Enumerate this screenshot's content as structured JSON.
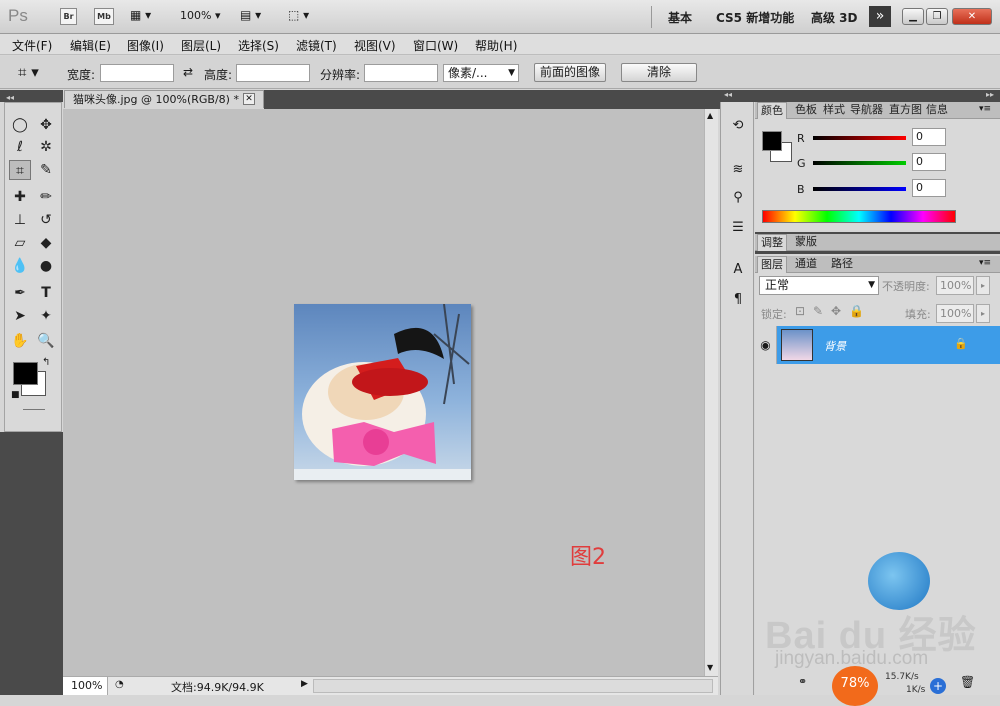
{
  "appbar": {
    "logo": "Ps",
    "bridge": "Br",
    "mini_bridge": "Mb",
    "zoom": "100%",
    "workspaces": [
      "基本",
      "CS5 新增功能",
      "高级 3D"
    ],
    "more": "»"
  },
  "menu": [
    "文件(F)",
    "编辑(E)",
    "图像(I)",
    "图层(L)",
    "选择(S)",
    "滤镜(T)",
    "视图(V)",
    "窗口(W)",
    "帮助(H)"
  ],
  "options": {
    "width_label": "宽度:",
    "height_label": "高度:",
    "resolution_label": "分辨率:",
    "unit": "像素/...",
    "front_image": "前面的图像",
    "clear": "清除"
  },
  "document": {
    "tab": "猫咪头像.jpg @ 100%(RGB/8) *",
    "annotation": "图2"
  },
  "status": {
    "zoom": "100%",
    "doc_size": "文档:94.9K/94.9K"
  },
  "color_panel": {
    "tabs": [
      "颜色",
      "色板",
      "样式",
      "导航器",
      "直方图",
      "信息"
    ],
    "r_label": "R",
    "g_label": "G",
    "b_label": "B",
    "r": "0",
    "g": "0",
    "b": "0"
  },
  "adjust_tabs": [
    "调整",
    "蒙版"
  ],
  "layers_panel": {
    "tabs": [
      "图层",
      "通道",
      "路径"
    ],
    "blend_mode": "正常",
    "opacity_label": "不透明度:",
    "opacity": "100%",
    "lock_label": "锁定:",
    "fill_label": "填充:",
    "fill": "100%",
    "layer_name": "背景"
  },
  "watermark": {
    "text": "Bai du 经验",
    "url": "jingyan.baidu.com"
  },
  "net": {
    "percent": "78%",
    "up": "15.7K/s",
    "down": "1K/s"
  }
}
